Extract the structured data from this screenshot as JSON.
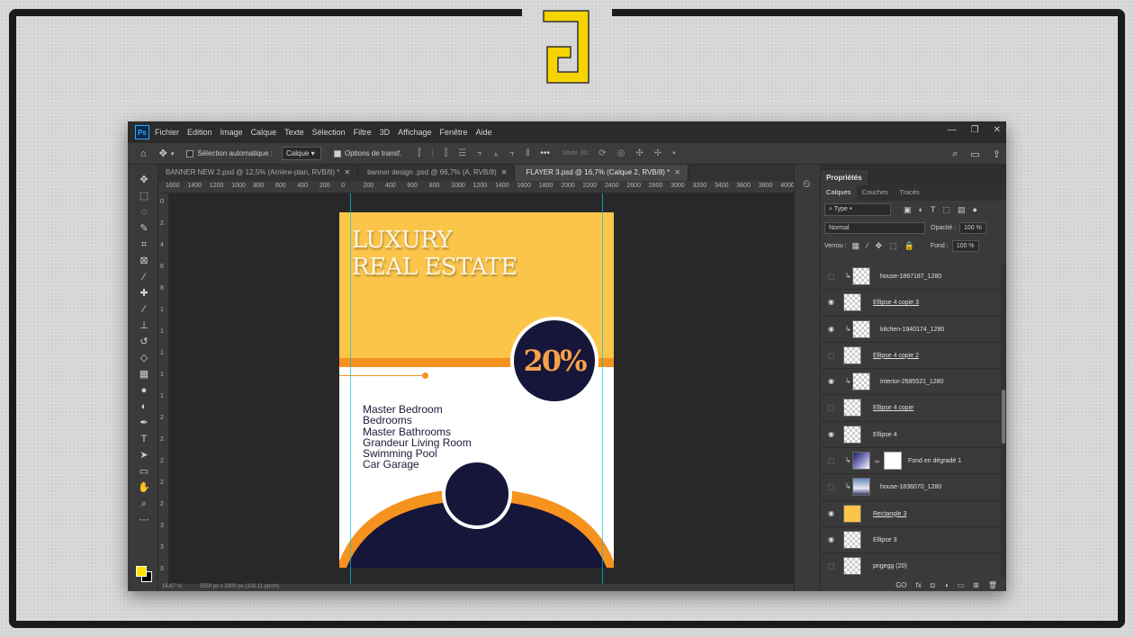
{
  "menubar": {
    "app_badge": "Ps",
    "items": [
      "Fichier",
      "Edition",
      "Image",
      "Calque",
      "Texte",
      "Sélection",
      "Filtre",
      "3D",
      "Affichage",
      "Fenêtre",
      "Aide"
    ],
    "window_controls": [
      "—",
      "❐",
      "✕"
    ]
  },
  "options": {
    "auto_select_label": "Sélection automatique :",
    "auto_select_value": "Calque",
    "transform_label": "Options de transf.",
    "mode3d_label": "Mode 3D :"
  },
  "tabs": [
    {
      "label": "BANNER NEW 2.psd @ 12,5% (Arrière-plan, RVB/8) *",
      "active": false
    },
    {
      "label": "banner design .psd @ 66,7% (A, RVB/8)",
      "active": false
    },
    {
      "label": "FLAYER 3.psd @ 16,7% (Calque 2, RVB/8) *",
      "active": true
    }
  ],
  "ruler_h": [
    "1600",
    "1400",
    "1200",
    "1000",
    "800",
    "600",
    "400",
    "200",
    "0",
    "200",
    "400",
    "600",
    "800",
    "1000",
    "1200",
    "1400",
    "1600",
    "1800",
    "2000",
    "2200",
    "2400",
    "2600",
    "2800",
    "3000",
    "3200",
    "3400",
    "3600",
    "3800",
    "4000"
  ],
  "ruler_v": [
    "0",
    "2",
    "4",
    "6",
    "8",
    "1",
    "1",
    "1",
    "1",
    "1",
    "2",
    "2",
    "2",
    "2",
    "2",
    "3",
    "3",
    "3"
  ],
  "status": {
    "zoom": "16,67 %",
    "dimensions": "2550 px x 3300 px (118,11 ppcm)"
  },
  "flyer": {
    "title_line1": "LUXURY",
    "title_line2": "REAL ESTATE",
    "discount": "20%",
    "features": [
      "Master Bedroom",
      "Bedrooms",
      "Master Bathrooms",
      "Grandeur Living Room",
      "Swimming Pool",
      "Car Garage"
    ],
    "colors": {
      "yellow": "#fbc54a",
      "orange": "#f6921e",
      "navy": "#16153a"
    }
  },
  "panel": {
    "title": "Propriétés",
    "subtabs": [
      "Calques",
      "Couches",
      "Tracés"
    ],
    "filter_value": "Type",
    "blend_mode": "Normal",
    "opacity_label": "Opacité :",
    "opacity_value": "100 %",
    "lock_label": "Verrou :",
    "fill_label": "Fond :",
    "fill_value": "100 %"
  },
  "layers": [
    {
      "name": "house-1867187_1280",
      "visible": false,
      "clipped": true,
      "thumb": "checker",
      "smart": false
    },
    {
      "name": "Ellipse 4 copie 3",
      "visible": true,
      "clipped": false,
      "thumb": "checker",
      "smart": true
    },
    {
      "name": "kitchen-1940174_1280",
      "visible": true,
      "clipped": true,
      "thumb": "checker",
      "smart": false
    },
    {
      "name": "Ellipse 4 copie 2",
      "visible": false,
      "clipped": false,
      "thumb": "checker",
      "smart": true
    },
    {
      "name": "interior-2685521_1280",
      "visible": true,
      "clipped": true,
      "thumb": "checker",
      "smart": false
    },
    {
      "name": "Ellipse 4 copie",
      "visible": false,
      "clipped": false,
      "thumb": "checker",
      "smart": true
    },
    {
      "name": "Ellipse 4",
      "visible": true,
      "clipped": false,
      "thumb": "checker",
      "smart": false
    },
    {
      "name": "Fond en dégradé 1",
      "visible": false,
      "clipped": true,
      "thumb": "grad",
      "smart": false
    },
    {
      "name": "house-1836070_1280",
      "visible": false,
      "clipped": true,
      "thumb": "photo",
      "smart": false
    },
    {
      "name": "Rectangle 3",
      "visible": true,
      "clipped": false,
      "thumb": "yellow",
      "smart": true
    },
    {
      "name": "Ellipse 3",
      "visible": true,
      "clipped": false,
      "thumb": "checker",
      "smart": false
    },
    {
      "name": "pngegg (20)",
      "visible": false,
      "clipped": false,
      "thumb": "checker",
      "smart": false
    }
  ],
  "layer_footer": [
    "GO",
    "fx",
    "◘",
    "◑",
    "▭",
    "⊞",
    "🗑"
  ]
}
